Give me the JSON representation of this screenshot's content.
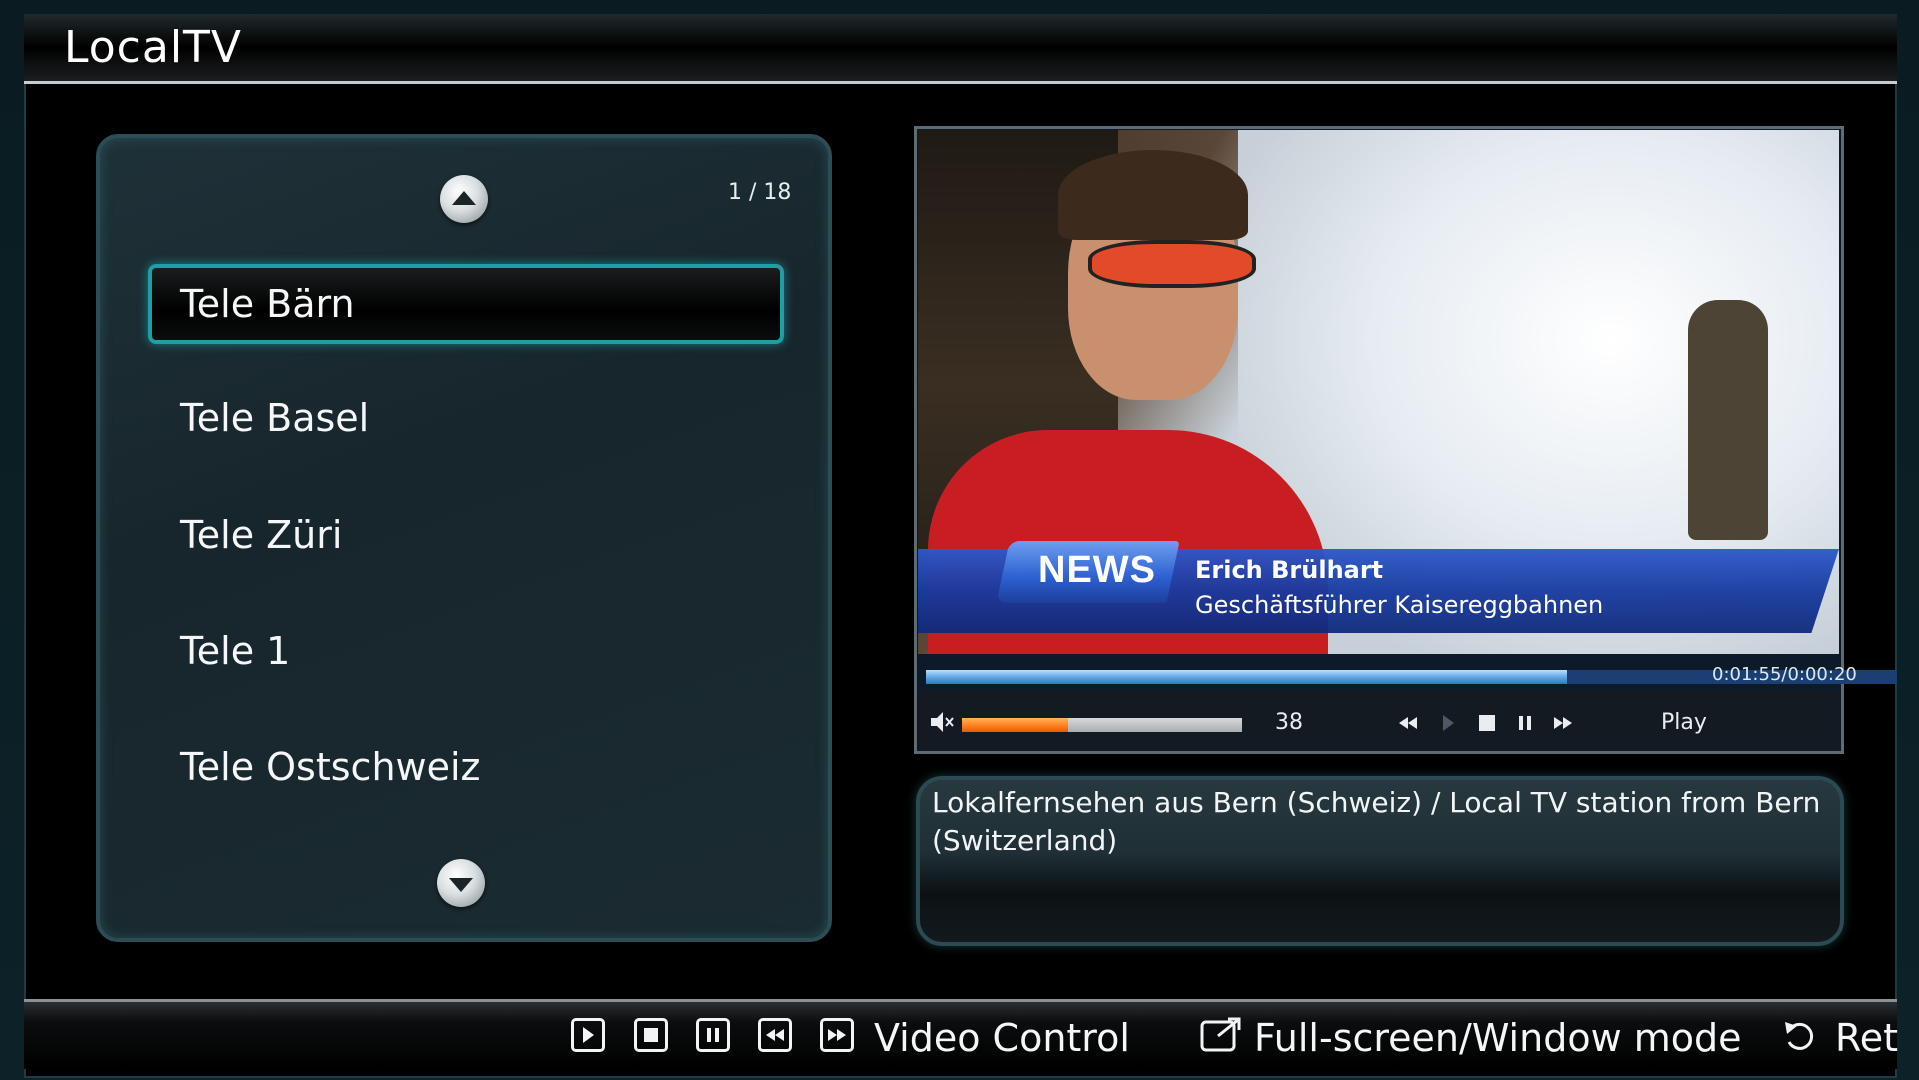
{
  "app": {
    "title": "LocalTV"
  },
  "channel_list": {
    "page_indicator": "1 / 18",
    "items": [
      {
        "label": "Tele Bärn",
        "selected": true
      },
      {
        "label": "Tele Basel",
        "selected": false
      },
      {
        "label": "Tele Züri",
        "selected": false
      },
      {
        "label": "Tele 1",
        "selected": false
      },
      {
        "label": "Tele Ostschweiz",
        "selected": false
      }
    ],
    "scroll_up_icon": "chevron-up-icon",
    "scroll_down_icon": "chevron-down-icon"
  },
  "video": {
    "lower_third": {
      "tag": "NEWS",
      "name": "Erich Brülhart",
      "role": "Geschäftsführer Kaisereggbahnen"
    },
    "progress": {
      "time_text": "0:01:55/0:00:20",
      "fraction": 0.66
    },
    "volume": {
      "value": "38",
      "fraction": 0.38
    },
    "status_label": "Play"
  },
  "description": {
    "text": "Lokalfernsehen aus Bern (Schweiz) / Local TV station from Bern (Switzerland)"
  },
  "bottom_bar": {
    "video_control_label": "Video Control",
    "fullscreen_label": "Full-screen/Window mode",
    "return_label": "Ret"
  },
  "colors": {
    "accent": "#1d9fa5",
    "progress": "#63a8e6",
    "volume": "#ff7a1a",
    "news_blue": "#173aa0"
  }
}
